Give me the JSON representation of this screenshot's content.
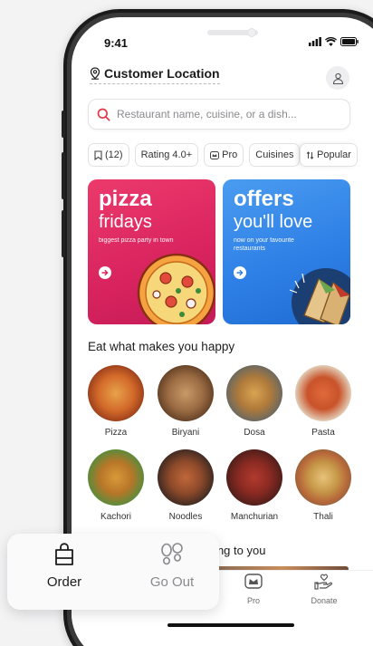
{
  "status": {
    "time": "9:41"
  },
  "header": {
    "location": "Customer Location"
  },
  "search": {
    "placeholder": "Restaurant name, cuisine, or a dish..."
  },
  "filters": [
    {
      "label": "(12)",
      "icon": "bookmark-icon"
    },
    {
      "label": "Rating 4.0+"
    },
    {
      "label": "Pro",
      "icon": "pro-icon"
    },
    {
      "label": "Cuisines"
    }
  ],
  "sort": {
    "label": "Popular",
    "icon": "sort-icon"
  },
  "banners": [
    {
      "title": "pizza",
      "subtitle": "fridays",
      "note": "biggest pizza party in town",
      "color_start": "#e8336a",
      "color_end": "#c2185b"
    },
    {
      "title": "offers",
      "subtitle": "you'll love",
      "note": "now on your favourite restaurants",
      "color_start": "#3b8fe8",
      "color_end": "#1e6fd4"
    }
  ],
  "section": {
    "title": "Eat what makes you happy"
  },
  "dishes": [
    {
      "label": "Pizza"
    },
    {
      "label": "Biryani"
    },
    {
      "label": "Dosa"
    },
    {
      "label": "Pasta"
    },
    {
      "label": "Kachori"
    },
    {
      "label": "Noodles"
    },
    {
      "label": "Manchurian"
    },
    {
      "label": "Thali"
    }
  ],
  "delivering": {
    "text": "vering to you"
  },
  "tabs": [
    {
      "label": "Pro",
      "icon": "pro-crown-icon"
    },
    {
      "label": "Donate",
      "icon": "donate-hand-icon"
    }
  ],
  "mode_switch": {
    "order_label": "Order",
    "goout_label": "Go Out"
  },
  "colors": {
    "accent": "#e23744",
    "text": "#1c1c1c"
  }
}
